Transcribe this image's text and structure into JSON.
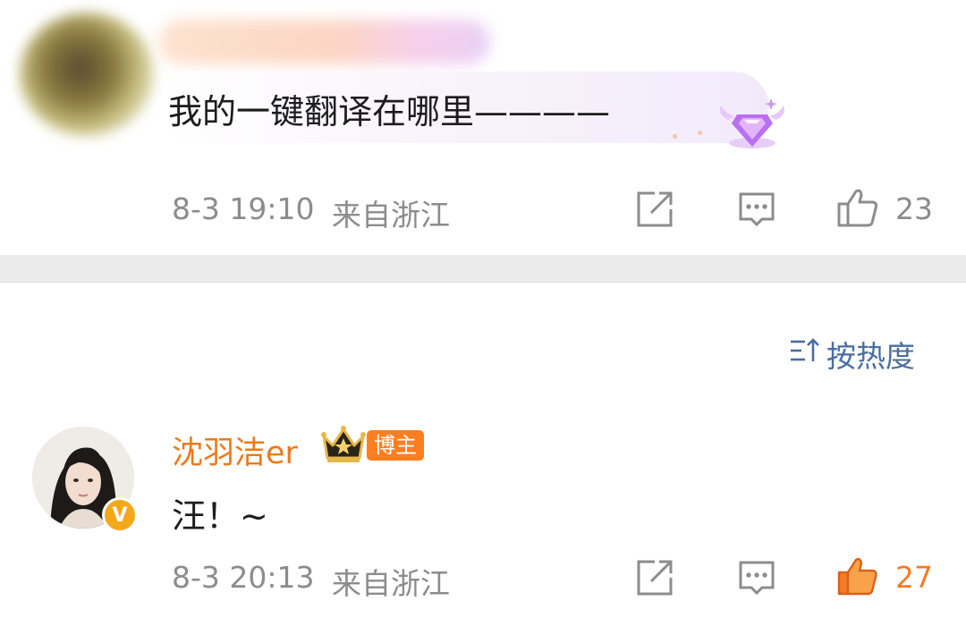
{
  "comments": [
    {
      "text": "我的一键翻译在哪里————",
      "time": "8-3 19:10",
      "location": "来自浙江",
      "likes": "23",
      "liked": false
    },
    {
      "username": "沈羽洁er",
      "badge": "博主",
      "verified_mark": "V",
      "text": "汪！~",
      "time": "8-3 20:13",
      "location": "来自浙江",
      "likes": "27",
      "liked": true
    }
  ],
  "sort": {
    "label": "按热度"
  },
  "colors": {
    "meta_gray": "#8c8c8c",
    "username_orange": "#eb7a1a",
    "badge_orange": "#ff7f1f",
    "like_active_orange": "#f47c24",
    "sort_blue": "#4a6da0",
    "separator_gray": "#ebebeb"
  },
  "icons": [
    "share-icon",
    "comment-icon",
    "like-icon",
    "sort-icon",
    "diamond-badge-icon",
    "crown-icon",
    "verified-icon"
  ]
}
